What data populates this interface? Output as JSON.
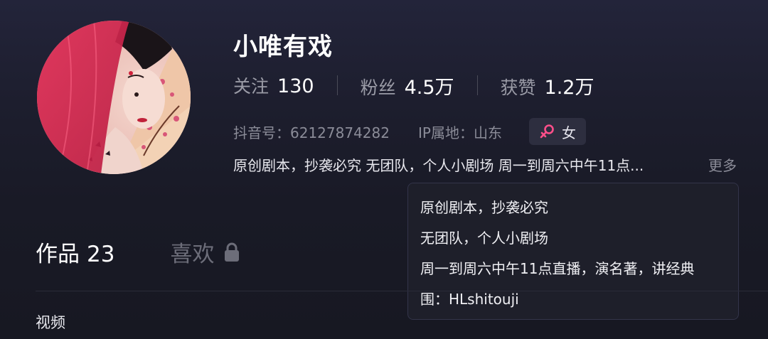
{
  "profile": {
    "name": "小唯有戏",
    "stats": [
      {
        "label": "关注",
        "value": "130"
      },
      {
        "label": "粉丝",
        "value": "4.5万"
      },
      {
        "label": "获赞",
        "value": "1.2万"
      }
    ],
    "douyin_id": "抖音号：62127874282",
    "ip_location": "IP属地：山东",
    "gender": {
      "label": "女",
      "icon": "female-icon"
    },
    "bio_preview": "原创剧本，抄袭必究 无团队，个人小剧场 周一到周六中午11点...",
    "more_label": "更多"
  },
  "bio_tooltip": {
    "lines": [
      "原创剧本，抄袭必究",
      "无团队，个人小剧场",
      "周一到周六中午11点直播，演名著，讲经典",
      "围：HLshitouji"
    ]
  },
  "tabs": {
    "works_label": "作品",
    "works_count": "23",
    "likes_label": "喜欢",
    "likes_icon": "lock-icon"
  },
  "section": {
    "label": "视频"
  },
  "colors": {
    "background": "#1d1e2e",
    "muted_text": "#8b8c98",
    "female_accent": "#ff4f8a"
  }
}
